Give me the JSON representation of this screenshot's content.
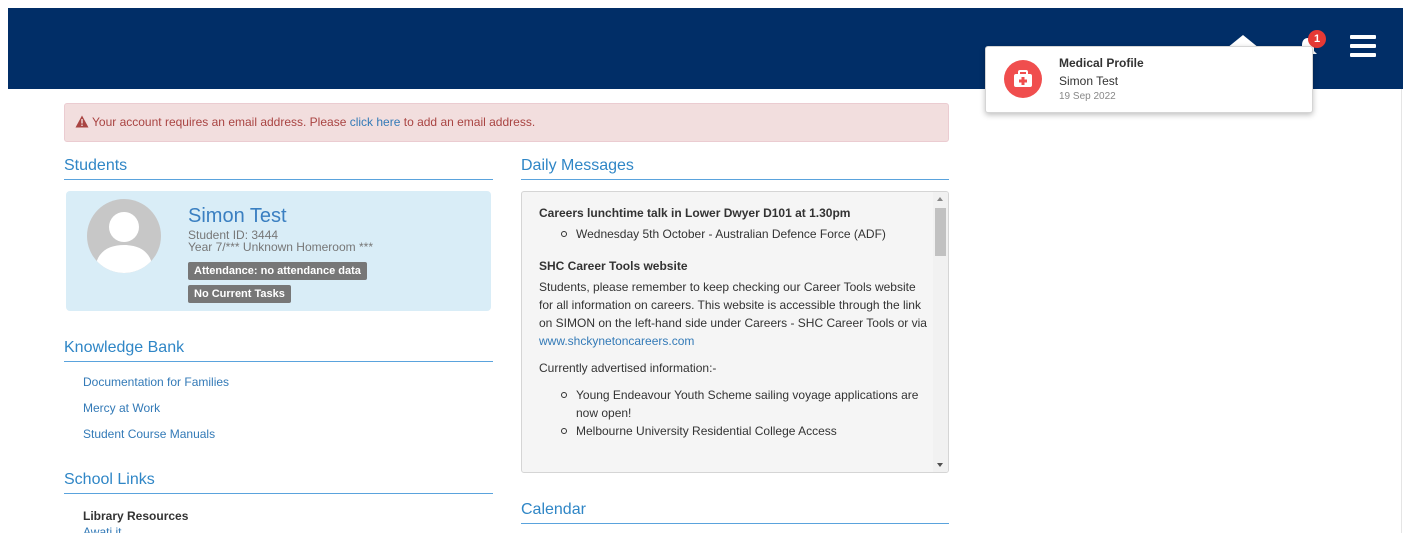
{
  "header": {
    "notification_count": "1",
    "icons": [
      "home-icon",
      "bell-icon",
      "menu-icon"
    ],
    "bar_color": "#012e67"
  },
  "notification": {
    "title": "Medical Profile",
    "name": "Simon Test",
    "date": "19 Sep 2022",
    "icon": "medical-kit-icon",
    "icon_color": "#f04e4e"
  },
  "alert": {
    "text_before": "Your account requires an email address. Please ",
    "link_text": "click here",
    "text_after": " to add an email address."
  },
  "students": {
    "heading": "Students",
    "name": "Simon Test",
    "student_id": "Student ID: 3444",
    "year": "Year 7/*** Unknown Homeroom ***",
    "attendance_label": "Attendance: no attendance data",
    "tasks_label": "No Current Tasks"
  },
  "knowledge_bank": {
    "heading": "Knowledge Bank",
    "links": [
      "Documentation for Families",
      "Mercy at Work",
      "Student Course Manuals"
    ]
  },
  "school_links": {
    "heading": "School Links",
    "subheading": "Library Resources",
    "partial_link": "Awati.it"
  },
  "daily_messages": {
    "heading": "Daily Messages",
    "item1_title": "Careers lunchtime talk in Lower Dwyer D101 at 1.30pm",
    "item1_bullet": "Wednesday 5th October - Australian Defence Force (ADF)",
    "item2_title": "SHC Career Tools website",
    "item2_text": "Students, please remember to keep checking our Career Tools website for all information on careers. This website is accessible through the link on SIMON on the left-hand side under Careers - SHC Career Tools or via ",
    "item2_link": "www.shckynetoncareers.com",
    "item3_text": "Currently advertised information:-",
    "item3_bullet1": "Young Endeavour Youth Scheme sailing voyage applications are now open!",
    "item3_bullet2": "Melbourne University Residential College Access"
  },
  "calendar": {
    "heading": "Calendar"
  }
}
